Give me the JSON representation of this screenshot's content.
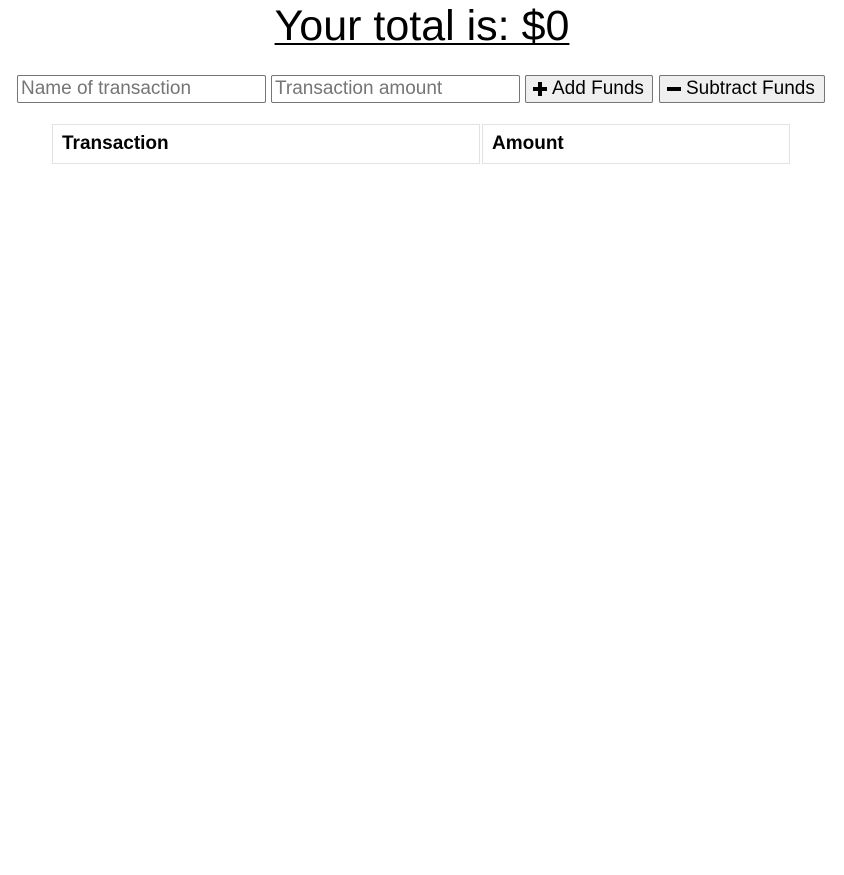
{
  "header": {
    "total_text": "Your total is: $0"
  },
  "form": {
    "name_placeholder": "Name of transaction",
    "amount_placeholder": "Transaction amount",
    "add_label": "Add Funds",
    "add_icon": "plus-icon",
    "subtract_label": "Subtract Funds",
    "subtract_icon": "minus-icon"
  },
  "table": {
    "columns": [
      "Transaction",
      "Amount"
    ],
    "rows": []
  }
}
